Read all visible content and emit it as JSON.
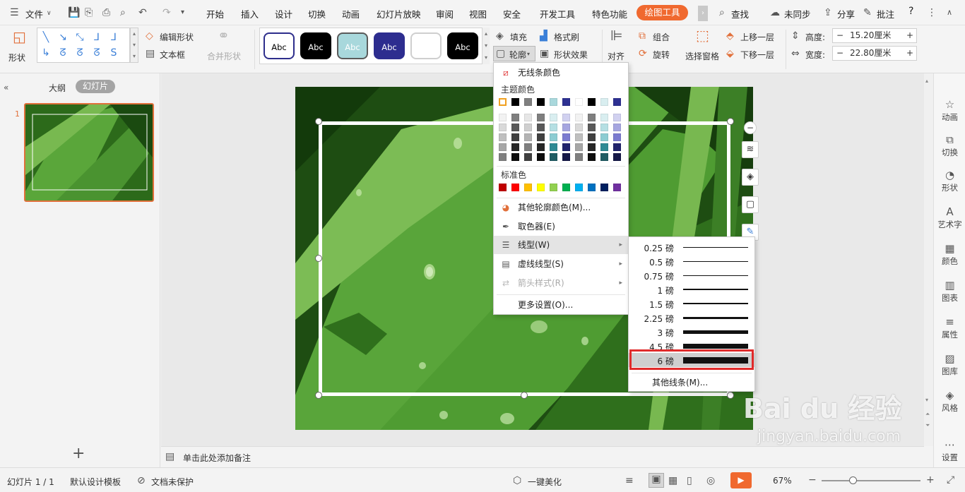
{
  "menubar": {
    "file_label": "文件",
    "tabs": [
      "开始",
      "插入",
      "设计",
      "切换",
      "动画",
      "幻灯片放映",
      "审阅",
      "视图",
      "安全",
      "开发工具",
      "特色功能"
    ],
    "active_tab": "绘图工具",
    "search_label": "查找",
    "sync_label": "未同步",
    "share_label": "分享",
    "comment_label": "批注",
    "help_label": "?"
  },
  "ribbon": {
    "shape_label": "形状",
    "edit_shape_label": "编辑形状",
    "textbox_label": "文本框",
    "merge_shape_label": "合并形状",
    "style_swatches": [
      {
        "text": "Abc",
        "bg": "#ffffff",
        "fg": "#000000",
        "border": "#2e2e8c"
      },
      {
        "text": "Abc",
        "bg": "#000000",
        "fg": "#ffffff",
        "border": "#000000"
      },
      {
        "text": "Abc",
        "bg": "#a8d8dc",
        "fg": "#ffffff",
        "border": "#5a5a5a"
      },
      {
        "text": "Abc",
        "bg": "#2d2d8f",
        "fg": "#ffffff",
        "border": "#2d2d8f"
      },
      {
        "text": "",
        "bg": "#ffffff",
        "fg": "#000000",
        "border": "#cfcfcf"
      },
      {
        "text": "Abc",
        "bg": "#000000",
        "fg": "#ffffff",
        "border": "#000000"
      }
    ],
    "fill_label": "填充",
    "outline_label": "轮廓",
    "format_painter_label": "格式刷",
    "shape_effect_label": "形状效果",
    "align_label": "对齐",
    "group_label": "组合",
    "rotate_label": "旋转",
    "selection_pane_label": "选择窗格",
    "bring_forward_label": "上移一层",
    "send_backward_label": "下移一层",
    "height_label": "高度:",
    "height_value": "15.20厘米",
    "width_label": "宽度:",
    "width_value": "22.80厘米"
  },
  "leftpanel": {
    "outline_tab": "大纲",
    "slides_tab": "幻灯片",
    "slide_number": "1",
    "add_button": "+"
  },
  "notes": {
    "placeholder": "单击此处添加备注"
  },
  "outline_menu": {
    "no_line_label": "无线条颜色",
    "theme_colors_label": "主题颜色",
    "theme_colors_top": [
      "#ffffff",
      "#000000",
      "#7f7f7f",
      "#000000",
      "#a9d8dc",
      "#2e3192",
      "#ffffff",
      "#000000",
      "#d9eef0",
      "#2e3192"
    ],
    "theme_shades": [
      [
        "#f2f2f2",
        "#7f7f7f",
        "#e6e6e6",
        "#7f7f7f",
        "#d9eef0",
        "#d1d1f0",
        "#f2f2f2",
        "#7f7f7f",
        "#d9eef0",
        "#d1d1f0"
      ],
      [
        "#d9d9d9",
        "#595959",
        "#cfcfcf",
        "#595959",
        "#b5dfe3",
        "#a6a6e0",
        "#d9d9d9",
        "#595959",
        "#b5dfe3",
        "#a6a6e0"
      ],
      [
        "#bfbfbf",
        "#404040",
        "#b3b3b3",
        "#404040",
        "#8cccd2",
        "#7b7bd0",
        "#bfbfbf",
        "#404040",
        "#8cccd2",
        "#7b7bd0"
      ],
      [
        "#a6a6a6",
        "#262626",
        "#7f7f7f",
        "#262626",
        "#2e8a94",
        "#20236c",
        "#a6a6a6",
        "#262626",
        "#2e8a94",
        "#20236c"
      ],
      [
        "#7f7f7f",
        "#0d0d0d",
        "#404040",
        "#0d0d0d",
        "#1f5c63",
        "#151848",
        "#7f7f7f",
        "#0d0d0d",
        "#1f5c63",
        "#151848"
      ]
    ],
    "standard_colors_label": "标准色",
    "standard_colors": [
      "#c00000",
      "#ff0000",
      "#ffc000",
      "#ffff00",
      "#92d050",
      "#00b050",
      "#00b0f0",
      "#0070c0",
      "#002060",
      "#7030a0"
    ],
    "more_colors_label": "其他轮廓颜色(M)...",
    "eyedropper_label": "取色器(E)",
    "line_type_label": "线型(W)",
    "dash_type_label": "虚线线型(S)",
    "arrow_style_label": "箭头样式(R)",
    "more_settings_label": "更多设置(O)..."
  },
  "linetype_submenu": {
    "weights": [
      {
        "label": "0.25 磅",
        "pt": 0.25
      },
      {
        "label": "0.5 磅",
        "pt": 0.5
      },
      {
        "label": "0.75 磅",
        "pt": 0.75
      },
      {
        "label": "1 磅",
        "pt": 1
      },
      {
        "label": "1.5 磅",
        "pt": 1.5
      },
      {
        "label": "2.25 磅",
        "pt": 2.25
      },
      {
        "label": "3 磅",
        "pt": 3
      },
      {
        "label": "4.5 磅",
        "pt": 4.5
      },
      {
        "label": "6 磅",
        "pt": 6
      }
    ],
    "selected_index": 8,
    "other_lines_label": "其他线条(M)..."
  },
  "rightbar": [
    {
      "icon": "star-icon",
      "glyph": "☆",
      "label": "动画"
    },
    {
      "icon": "transition-icon",
      "glyph": "⧉",
      "label": "切换"
    },
    {
      "icon": "shapes-icon",
      "glyph": "◔",
      "label": "形状"
    },
    {
      "icon": "wordart-icon",
      "glyph": "A",
      "label": "艺术字"
    },
    {
      "icon": "color-icon",
      "glyph": "▦",
      "label": "颜色"
    },
    {
      "icon": "chart-icon",
      "glyph": "▥",
      "label": "图表"
    },
    {
      "icon": "properties-icon",
      "glyph": "≡",
      "label": "属性"
    },
    {
      "icon": "image-icon",
      "glyph": "▨",
      "label": "图库"
    },
    {
      "icon": "style-icon",
      "glyph": "◈",
      "label": "风格"
    },
    {
      "icon": "settings-icon",
      "glyph": "⋯",
      "label": "设置"
    }
  ],
  "statusbar": {
    "slide_info": "幻灯片 1 / 1",
    "template_label": "默认设计模板",
    "protect_label": "文档未保护",
    "beautify_label": "一键美化",
    "zoom_value": "67%"
  },
  "watermark": {
    "brand": "Bai du 经验",
    "url": "jingyan.baidu.com"
  },
  "colors": {
    "accent_orange": "#f0692f",
    "highlight_red": "#e02b2b"
  }
}
